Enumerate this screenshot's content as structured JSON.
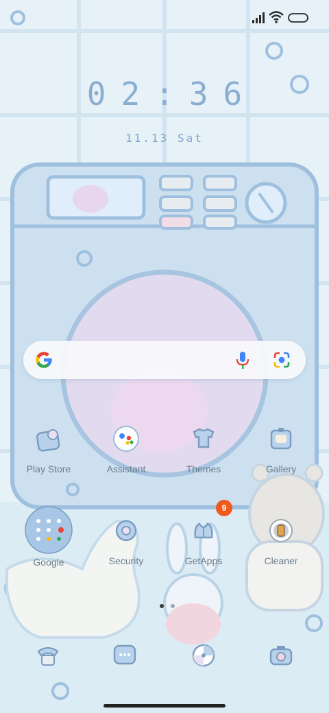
{
  "colors": {
    "accent": "#8aaed0",
    "label": "#6b7c8c",
    "badge": "#f05a1c",
    "google_blue": "#4285F4",
    "google_red": "#EA4335",
    "google_yellow": "#FBBC05",
    "google_green": "#34A853"
  },
  "status_bar": {
    "icons": [
      "signal-icon",
      "wifi-icon",
      "battery-icon"
    ]
  },
  "clock": {
    "time": "02:36",
    "date": "11.13 Sat"
  },
  "search": {
    "icons": [
      "google-logo-icon",
      "microphone-icon",
      "google-lens-icon"
    ]
  },
  "apps_row1": [
    {
      "label": "Play Store",
      "icon": "play-store-icon"
    },
    {
      "label": "Assistant",
      "icon": "assistant-icon"
    },
    {
      "label": "Themes",
      "icon": "themes-icon"
    },
    {
      "label": "Gallery",
      "icon": "gallery-icon"
    }
  ],
  "apps_row2": [
    {
      "label": "Google",
      "icon": "google-folder-icon"
    },
    {
      "label": "Security",
      "icon": "security-icon"
    },
    {
      "label": "GetApps",
      "icon": "getapps-icon",
      "badge": "9"
    },
    {
      "label": "Cleaner",
      "icon": "cleaner-icon"
    }
  ],
  "page_indicator": {
    "pages": 2,
    "current": 1
  },
  "dock": [
    {
      "icon": "phone-icon"
    },
    {
      "icon": "messages-icon"
    },
    {
      "icon": "browser-icon"
    },
    {
      "icon": "camera-icon"
    }
  ]
}
